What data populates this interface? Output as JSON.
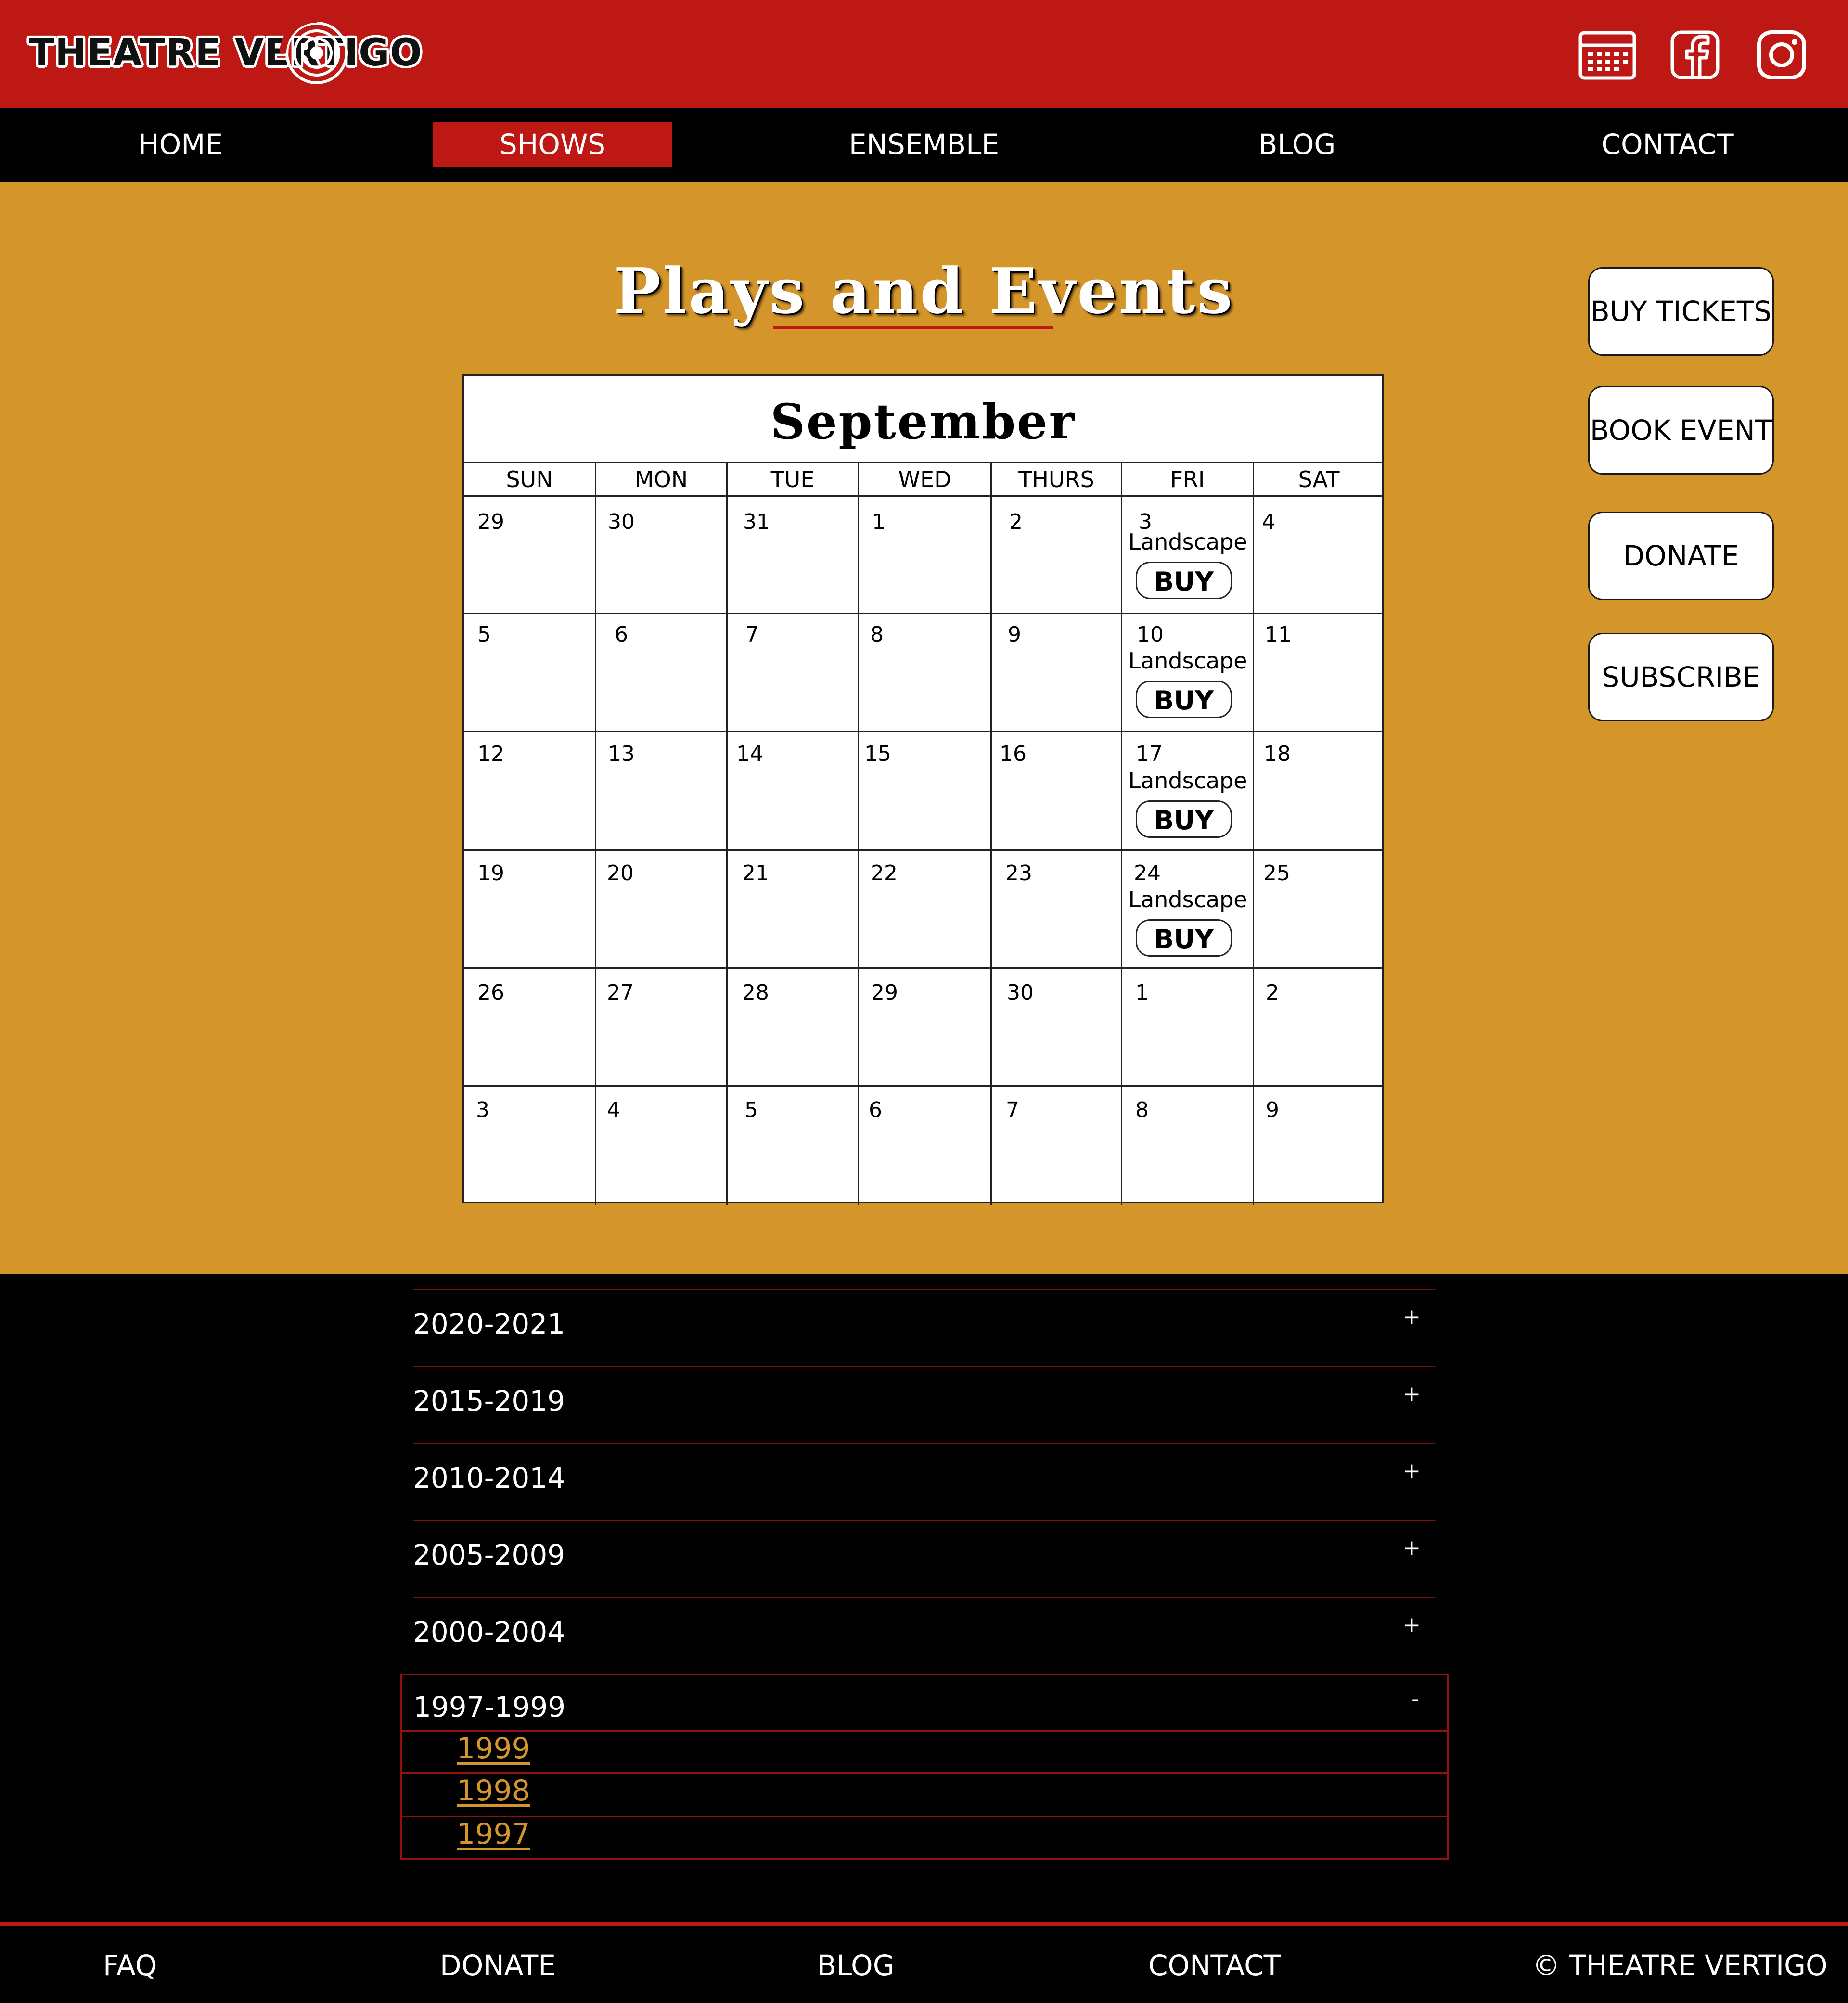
{
  "header": {
    "brand": "THEATRE VERTIGO",
    "icons": [
      "calendar-icon",
      "facebook-icon",
      "instagram-icon"
    ]
  },
  "nav": {
    "items": [
      {
        "label": "HOME",
        "active": false
      },
      {
        "label": "SHOWS",
        "active": true
      },
      {
        "label": "ENSEMBLE",
        "active": false
      },
      {
        "label": "BLOG",
        "active": false
      },
      {
        "label": "CONTACT",
        "active": false
      }
    ]
  },
  "main": {
    "title": "Plays and Events",
    "side_buttons": [
      "BUY TICKETS",
      "BOOK EVENT",
      "DONATE",
      "SUBSCRIBE"
    ]
  },
  "calendar": {
    "month": "September",
    "days_of_week": [
      "SUN",
      "MON",
      "TUE",
      "WED",
      "THURS",
      "FRI",
      "SAT"
    ],
    "weeks": [
      [
        "29",
        "30",
        "31",
        "1",
        "2",
        "3",
        "4"
      ],
      [
        "5",
        "6",
        "7",
        "8",
        "9",
        "10",
        "11"
      ],
      [
        "12",
        "13",
        "14",
        "15",
        "16",
        "17",
        "18"
      ],
      [
        "19",
        "20",
        "21",
        "22",
        "23",
        "24",
        "25"
      ],
      [
        "26",
        "27",
        "28",
        "29",
        "30",
        "1",
        "2"
      ],
      [
        "3",
        "4",
        "5",
        "6",
        "7",
        "8",
        "9"
      ]
    ],
    "events": [
      {
        "title": "Landscape",
        "button": "BUY"
      },
      {
        "title": "Landscape",
        "button": "BUY"
      },
      {
        "title": "Landscape",
        "button": "BUY"
      },
      {
        "title": "Landscape",
        "button": "BUY"
      }
    ]
  },
  "archive": {
    "sections": [
      {
        "label": "2020-2021",
        "toggle": "+"
      },
      {
        "label": "2015-2019",
        "toggle": "+"
      },
      {
        "label": "2010-2014",
        "toggle": "+"
      },
      {
        "label": "2005-2009",
        "toggle": "+"
      },
      {
        "label": "2000-2004",
        "toggle": "+"
      }
    ],
    "open_section": {
      "label": "1997-1999",
      "toggle": "-",
      "years": [
        "1999",
        "1998",
        "1997"
      ]
    }
  },
  "footer": {
    "items": [
      "FAQ",
      "DONATE",
      "BLOG",
      "CONTACT",
      "© THEATRE VERTIGO"
    ]
  },
  "colors": {
    "brand_red": "#be1814",
    "gold": "#d4952a",
    "black": "#000000",
    "white": "#ffffff"
  }
}
